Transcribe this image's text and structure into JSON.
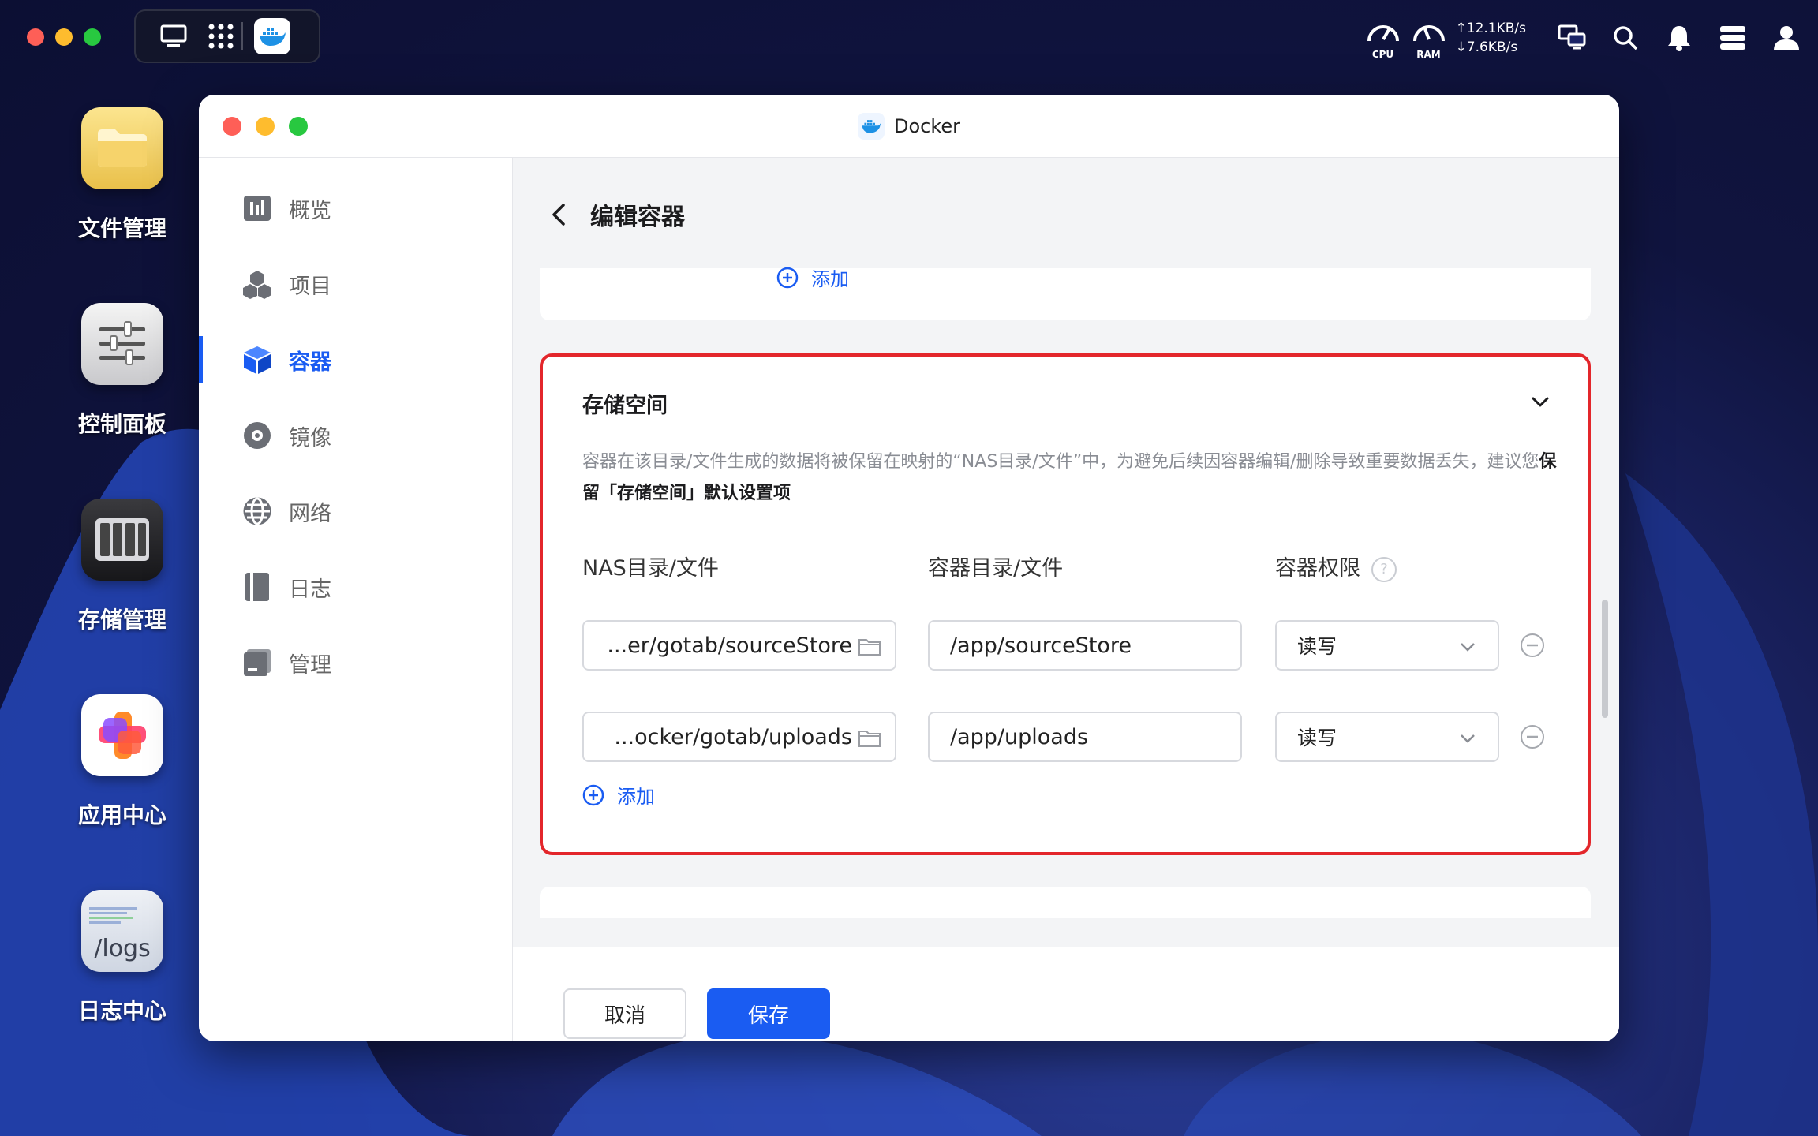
{
  "topbar": {
    "cpu_label": "CPU",
    "ram_label": "RAM",
    "upload_speed": "12.1KB/s",
    "download_speed": "7.6KB/s"
  },
  "desktop": {
    "items": [
      {
        "label": "文件管理",
        "icon": "folder-icon"
      },
      {
        "label": "控制面板",
        "icon": "sliders-icon"
      },
      {
        "label": "存储管理",
        "icon": "storage-icon"
      },
      {
        "label": "应用中心",
        "icon": "app-center-icon"
      },
      {
        "label": "日志中心",
        "icon": "logs-icon",
        "icon_text": "/logs"
      }
    ]
  },
  "window": {
    "title": "Docker"
  },
  "sidebar": {
    "items": [
      {
        "label": "概览",
        "icon": "overview-icon",
        "active": false
      },
      {
        "label": "项目",
        "icon": "project-icon",
        "active": false
      },
      {
        "label": "容器",
        "icon": "container-icon",
        "active": true
      },
      {
        "label": "镜像",
        "icon": "image-icon",
        "active": false
      },
      {
        "label": "网络",
        "icon": "network-icon",
        "active": false
      },
      {
        "label": "日志",
        "icon": "log-icon",
        "active": false
      },
      {
        "label": "管理",
        "icon": "manage-icon",
        "active": false
      }
    ]
  },
  "main": {
    "page_title": "编辑容器",
    "prev_add_label": "添加",
    "storage": {
      "title": "存储空间",
      "desc_prefix": "容器在该目录/文件生成的数据将被保留在映射的“NAS目录/文件”中，为避免后续因容器编辑/删除导致重要数据丢失，建议您",
      "desc_strong": "保留「存储空间」默认设置项",
      "col_nas": "NAS目录/文件",
      "col_container": "容器目录/文件",
      "col_perm": "容器权限",
      "rows": [
        {
          "nas": "...er/gotab/sourceStore",
          "container": "/app/sourceStore",
          "perm": "读写"
        },
        {
          "nas": "...ocker/gotab/uploads",
          "container": "/app/uploads",
          "perm": "读写"
        }
      ],
      "add_label": "添加"
    }
  },
  "footer": {
    "cancel_label": "取消",
    "save_label": "保存"
  },
  "colors": {
    "accent": "#1a5cf2",
    "highlight_border": "#e3262b"
  }
}
